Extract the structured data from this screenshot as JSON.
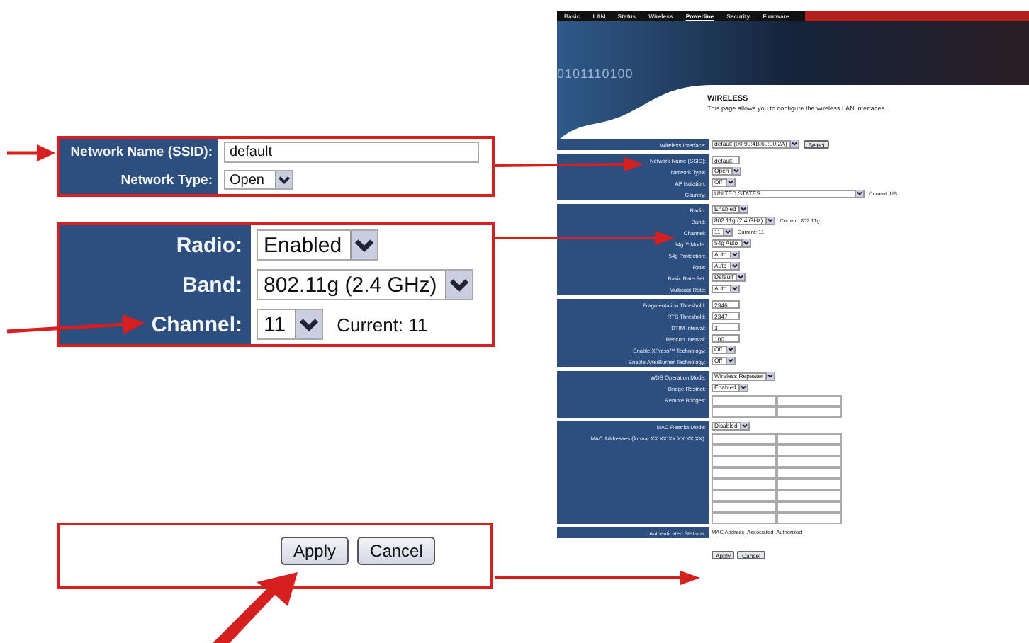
{
  "callouts": [
    {
      "kind": "fields",
      "rows": [
        {
          "label": "Network Name (SSID):",
          "kind": "input",
          "value": "default"
        },
        {
          "label": "Network Type:",
          "kind": "select",
          "value": "Open"
        }
      ]
    },
    {
      "kind": "fields_large",
      "rows": [
        {
          "label": "Radio:",
          "kind": "select",
          "value": "Enabled"
        },
        {
          "label": "Band:",
          "kind": "select",
          "value": "802.11g (2.4 GHz)"
        },
        {
          "label": "Channel:",
          "kind": "select",
          "value": "11",
          "note": "Current: 11"
        }
      ]
    },
    {
      "kind": "buttons",
      "buttons": [
        "Apply",
        "Cancel"
      ]
    }
  ],
  "router_page": {
    "nav": [
      {
        "label": "Basic",
        "selected": false
      },
      {
        "label": "LAN",
        "selected": false
      },
      {
        "label": "Status",
        "selected": false
      },
      {
        "label": "Wireless",
        "selected": false
      },
      {
        "label": "Powerline",
        "selected": true
      },
      {
        "label": "Security",
        "selected": false
      },
      {
        "label": "Firmware",
        "selected": false
      }
    ],
    "banner_text": "0101110100",
    "title": "WIRELESS",
    "description": "This page allows you to configure the wireless LAN interfaces.",
    "sections": [
      {
        "rows": [
          {
            "label": "Wireless Interface:",
            "kind": "select_button",
            "value": "default (00:90:4B:60:00:2A)",
            "button": "Select"
          }
        ]
      },
      {
        "rows": [
          {
            "label": "Network Name (SSID):",
            "kind": "input",
            "value": "default"
          },
          {
            "label": "Network Type:",
            "kind": "select",
            "value": "Open"
          },
          {
            "label": "AP Isolation:",
            "kind": "select",
            "value": "Off"
          },
          {
            "label": "Country:",
            "kind": "select_wide",
            "value": "UNITED STATES",
            "note": "Current: US"
          }
        ]
      },
      {
        "rows": [
          {
            "label": "Radio:",
            "kind": "select",
            "value": "Enabled"
          },
          {
            "label": "Band:",
            "kind": "select",
            "value": "802.11g (2.4 GHz)",
            "note": "Current: 802.11g"
          },
          {
            "label": "Channel:",
            "kind": "select",
            "value": "11",
            "note": "Current: 11"
          },
          {
            "label": "54g™ Mode:",
            "kind": "select",
            "value": "54g Auto"
          },
          {
            "label": "54g Protection:",
            "kind": "select",
            "value": "Auto"
          },
          {
            "label": "Rate:",
            "kind": "select",
            "value": "Auto"
          },
          {
            "label": "Basic Rate Set:",
            "kind": "select",
            "value": "Default"
          },
          {
            "label": "Multicast Rate:",
            "kind": "select",
            "value": "Auto"
          }
        ]
      },
      {
        "rows": [
          {
            "label": "Fragmentation Threshold:",
            "kind": "input",
            "value": "2346"
          },
          {
            "label": "RTS Threshold:",
            "kind": "input",
            "value": "2347"
          },
          {
            "label": "DTIM Interval:",
            "kind": "input",
            "value": "3"
          },
          {
            "label": "Beacon Interval:",
            "kind": "input",
            "value": "100"
          },
          {
            "label": "Enable XPress™ Technology:",
            "kind": "select",
            "value": "Off"
          },
          {
            "label": "Enable AfterBurner Technology:",
            "kind": "select",
            "value": "Off"
          }
        ]
      },
      {
        "rows": [
          {
            "label": "WDS Operation Mode:",
            "kind": "select",
            "value": "Wireless Repeater"
          },
          {
            "label": "Bridge Restrict:",
            "kind": "select",
            "value": "Enabled"
          },
          {
            "label": "Remote Bridges:",
            "kind": "bridge_table"
          }
        ]
      },
      {
        "rows": [
          {
            "label": "MAC Restrict Mode:",
            "kind": "select",
            "value": "Disabled"
          },
          {
            "label": "MAC Addresses (format XX:XX:XX:XX:XX:XX):",
            "kind": "mac_table"
          }
        ]
      },
      {
        "rows": [
          {
            "label": "Authenticated Stations:",
            "kind": "text",
            "value": "MAC Address  Associated  Authorized"
          }
        ]
      }
    ],
    "buttons": [
      "Apply",
      "Cancel"
    ]
  }
}
